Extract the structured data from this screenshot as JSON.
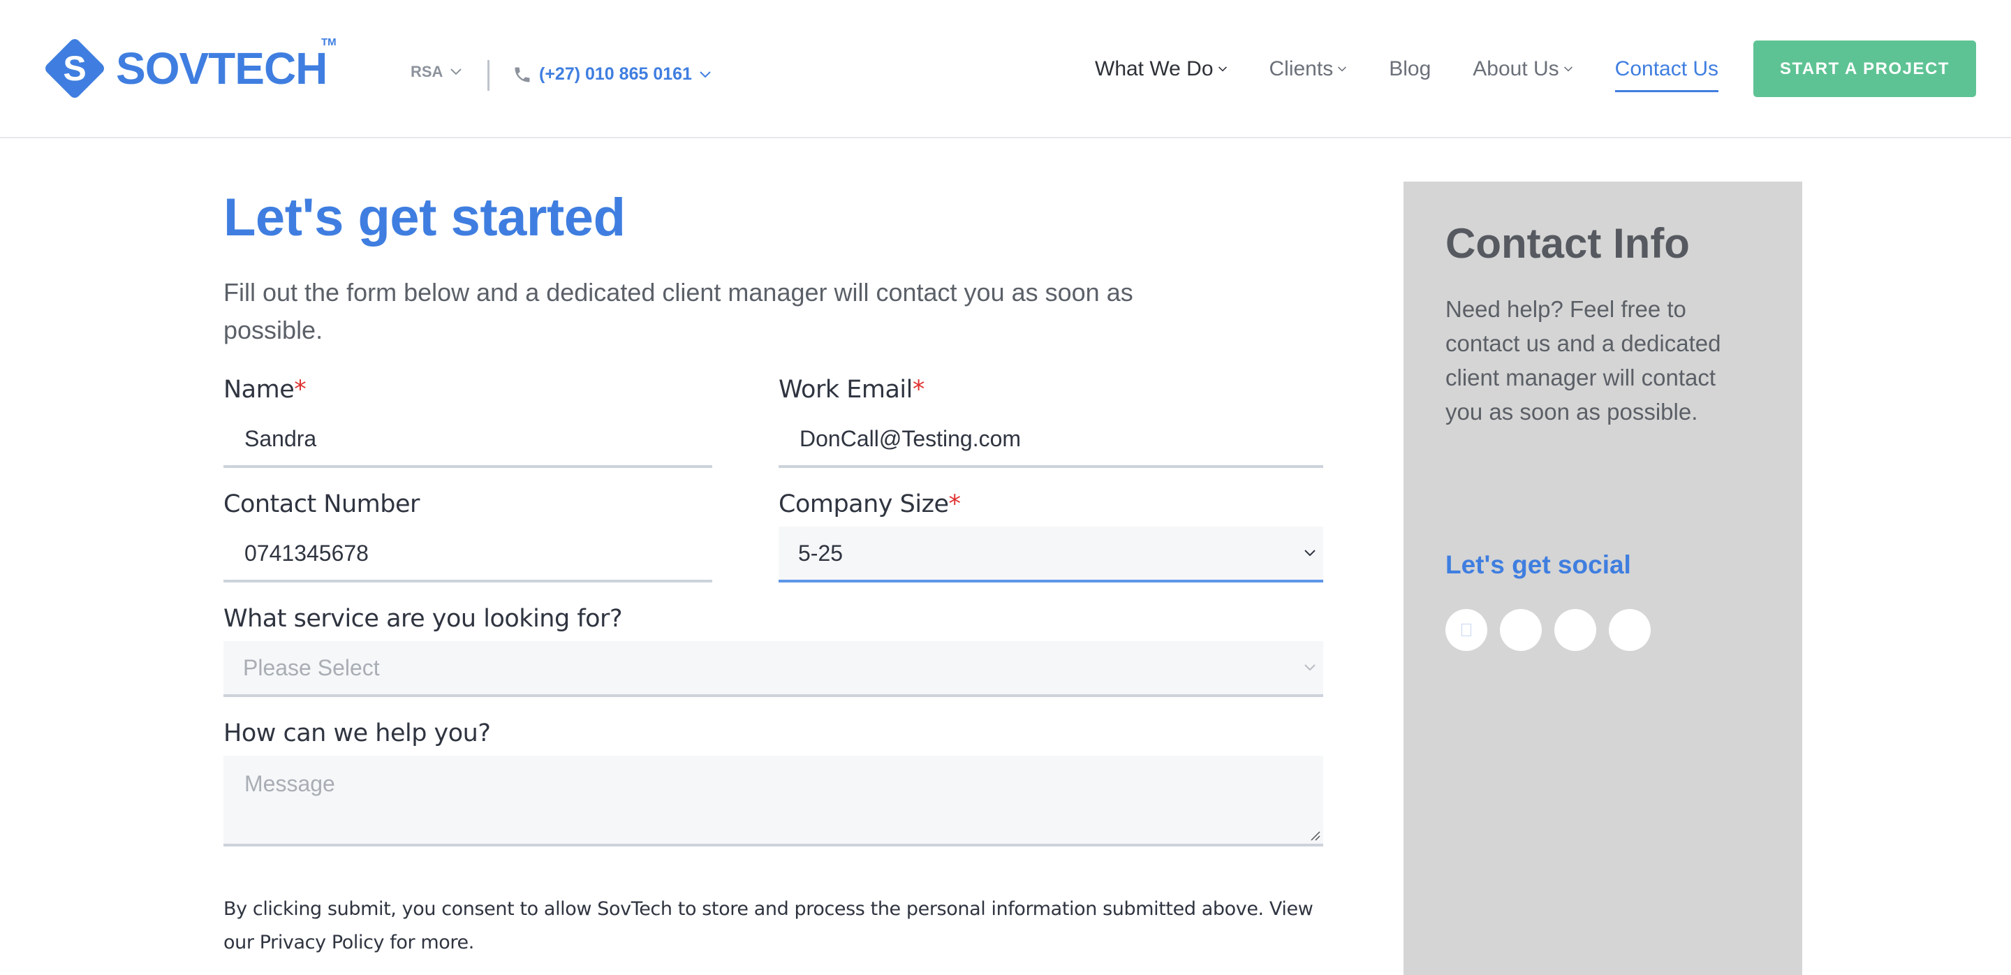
{
  "header": {
    "brand": "SOVTECH",
    "trademark": "TM",
    "region": "RSA",
    "phone": "(+27) 010 865 0161",
    "nav": [
      {
        "label": "What We Do",
        "dropdown": true
      },
      {
        "label": "Clients",
        "dropdown": true
      },
      {
        "label": "Blog",
        "dropdown": false
      },
      {
        "label": "About Us",
        "dropdown": true
      },
      {
        "label": "Contact Us",
        "dropdown": false,
        "active": true
      }
    ],
    "cta_label": "START A PROJECT"
  },
  "form": {
    "title": "Let's get started",
    "intro": "Fill out the form below and a dedicated client manager will contact you as soon as possible.",
    "name": {
      "label": "Name",
      "required_mark": "*",
      "value": "Sandra"
    },
    "email": {
      "label": "Work Email",
      "required_mark": "*",
      "value": "DonCall@Testing.com"
    },
    "contact_number": {
      "label": "Contact Number",
      "value": "0741345678"
    },
    "company_size": {
      "label": "Company Size",
      "required_mark": "*",
      "value": "5-25"
    },
    "service": {
      "label": "What service are you looking for?",
      "placeholder": "Please Select"
    },
    "message": {
      "label": "How can we help you?",
      "placeholder": "Message"
    },
    "consent": "By clicking submit, you consent to allow SovTech to store and process the personal information submitted above. View our Privacy Policy for more."
  },
  "sidebar": {
    "title": "Contact Info",
    "text": "Need help? Feel free to contact us and a dedicated client manager will contact you as soon as possible.",
    "social_title": "Let's get social",
    "social_icons": [
      "social-icon-1",
      "social-icon-2",
      "social-icon-3",
      "social-icon-4"
    ]
  },
  "colors": {
    "brand_blue": "#3f7ee0",
    "cta_green": "#5ec394",
    "sidebar_gray": "#d5d5d5",
    "required_red": "#e03131"
  }
}
